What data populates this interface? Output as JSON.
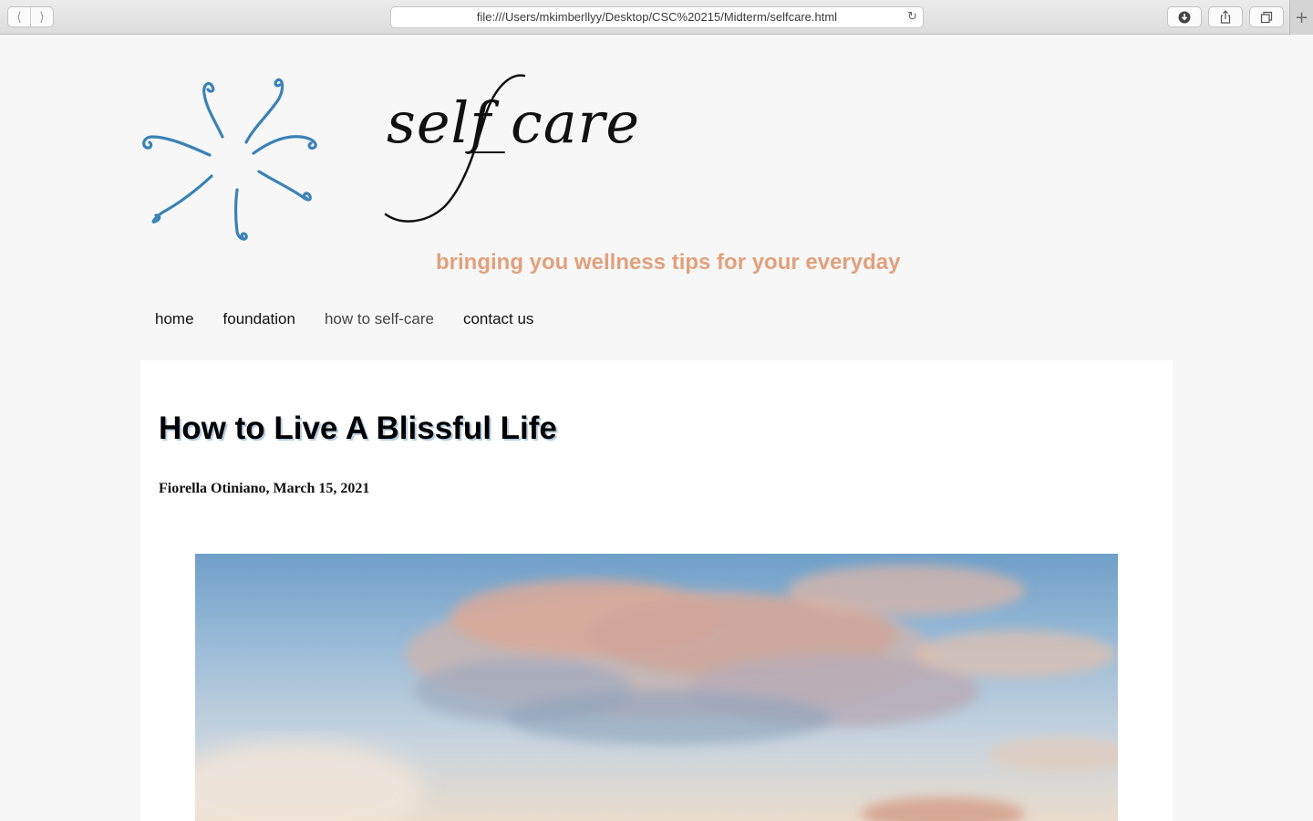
{
  "browser": {
    "back_icon": "chevron-left-icon",
    "forward_icon": "chevron-right-icon",
    "url": "file:///Users/mkimberllyy/Desktop/CSC%20215/Midterm/selfcare.html",
    "reload_icon": "reload-icon",
    "download_icon": "download-icon",
    "share_icon": "share-icon",
    "tabs_icon": "tabs-icon",
    "new_tab_icon": "plus-icon"
  },
  "site": {
    "brand": "self care",
    "tagline": "bringing you wellness tips for your everyday",
    "logo_icon": "swirl-star-logo-icon",
    "logo_color": "#3b82b6",
    "tagline_color": "#e2a07c"
  },
  "nav": {
    "items": [
      {
        "label": "home"
      },
      {
        "label": "foundation"
      },
      {
        "label": "how to self-care"
      },
      {
        "label": "contact us"
      }
    ]
  },
  "article": {
    "title": "How to Live A Blissful Life",
    "byline": "Fiorella Otiniano, March 15, 2021",
    "hero_image": "sky-clouds-image"
  }
}
